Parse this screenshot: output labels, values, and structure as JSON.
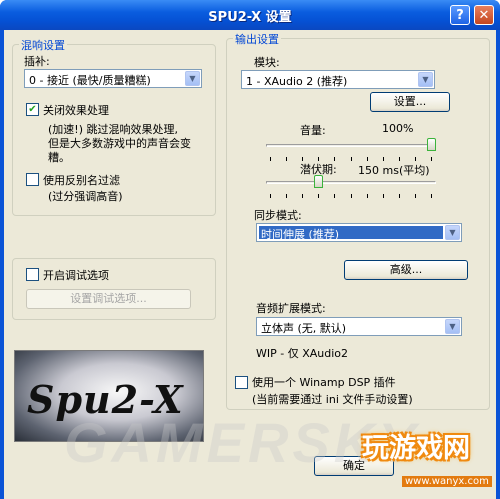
{
  "window": {
    "title": "SPU2-X 设置",
    "help": "?",
    "close": "✕"
  },
  "reverb": {
    "group_title": "混响设置",
    "interp_label": "插补:",
    "interp_value": "0 - 接近 (最快/质量糟糕)",
    "disable_effects_label": "关闭效果处理",
    "disable_effects_checked": true,
    "disable_effects_desc1": "(加速!) 跳过混响效果处理,",
    "disable_effects_desc2": "但是大多数游戏中的声音会变",
    "disable_effects_desc3": "糟。",
    "antialias_label": "使用反别名过滤",
    "antialias_desc": "(过分强调高音)",
    "antialias_checked": false
  },
  "debug": {
    "enable_label": "开启调试选项",
    "enable_checked": false,
    "config_button": "设置调试选项..."
  },
  "logo": {
    "text": "Spu2-X"
  },
  "output": {
    "group_title": "输出设置",
    "module_label": "模块:",
    "module_value": "1 - XAudio 2 (推荐)",
    "config_button": "设置...",
    "volume_label": "音量:",
    "volume_value": "100%",
    "volume_level": 1.0,
    "latency_label": "潜伏期:",
    "latency_value": "150 ms(平均)",
    "latency_level": 0.3,
    "sync_label": "同步模式:",
    "sync_value": "时间伸展 (推荐)",
    "advanced_button": "高级...",
    "expansion_label": "音频扩展模式:",
    "expansion_value": "立体声 (无, 默认)",
    "wip_note": "WIP - 仅 XAudio2",
    "winamp_label": "使用一个 Winamp DSP 插件",
    "winamp_desc": "(当前需要通过 ini 文件手动设置)",
    "winamp_checked": false
  },
  "footer": {
    "ok_button": "确定"
  },
  "watermarks": {
    "center": "GAMERSKY",
    "corner": "玩游戏网",
    "corner_url": "www.wanyx.com"
  }
}
